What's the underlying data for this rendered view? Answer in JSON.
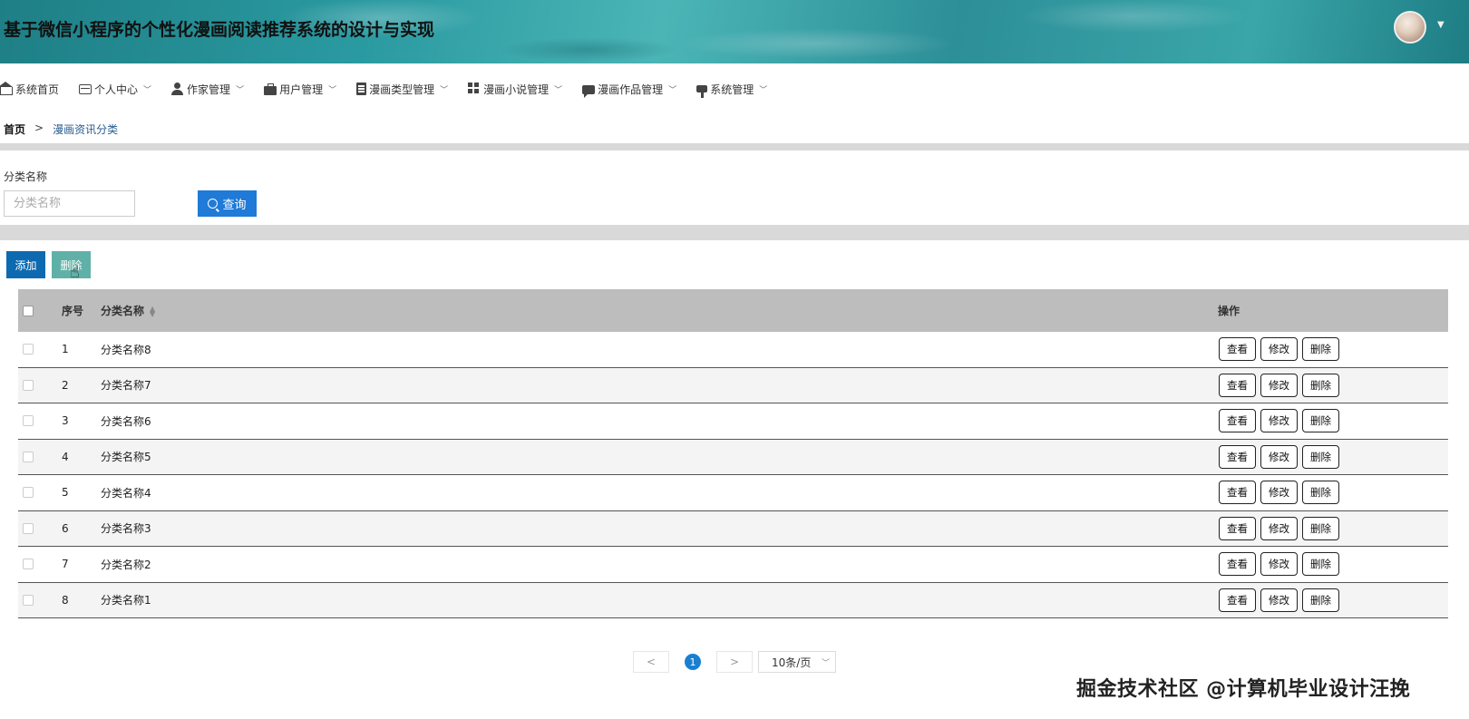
{
  "header": {
    "title": "基于微信小程序的个性化漫画阅读推荐系统的设计与实现"
  },
  "nav": [
    {
      "label": "系统首页",
      "icon": "home-icon",
      "dropdown": false
    },
    {
      "label": "个人中心",
      "icon": "profile-card-icon",
      "dropdown": true
    },
    {
      "label": "作家管理",
      "icon": "user-icon",
      "dropdown": true
    },
    {
      "label": "用户管理",
      "icon": "briefcase-icon",
      "dropdown": true
    },
    {
      "label": "漫画类型管理",
      "icon": "clipboard-icon",
      "dropdown": true
    },
    {
      "label": "漫画小说管理",
      "icon": "grid-icon",
      "dropdown": true
    },
    {
      "label": "漫画作品管理",
      "icon": "chat-icon",
      "dropdown": true
    },
    {
      "label": "系统管理",
      "icon": "pin-icon",
      "dropdown": true
    }
  ],
  "breadcrumb": {
    "home": "首页",
    "separator": ">",
    "current": "漫画资讯分类"
  },
  "search": {
    "label": "分类名称",
    "placeholder": "分类名称",
    "value": "",
    "button": "查询"
  },
  "toolbar": {
    "add": "添加",
    "delete": "删除"
  },
  "table": {
    "headers": {
      "index": "序号",
      "name": "分类名称",
      "actions": "操作"
    },
    "rows": [
      {
        "index": "1",
        "name": "分类名称8"
      },
      {
        "index": "2",
        "name": "分类名称7"
      },
      {
        "index": "3",
        "name": "分类名称6"
      },
      {
        "index": "4",
        "name": "分类名称5"
      },
      {
        "index": "5",
        "name": "分类名称4"
      },
      {
        "index": "6",
        "name": "分类名称3"
      },
      {
        "index": "7",
        "name": "分类名称2"
      },
      {
        "index": "8",
        "name": "分类名称1"
      }
    ],
    "row_actions": {
      "view": "查看",
      "edit": "修改",
      "delete": "删除"
    }
  },
  "pagination": {
    "prev": "<",
    "current_page": "1",
    "next": ">",
    "page_size": "10条/页"
  },
  "watermark": "掘金技术社区 @计算机毕业设计汪挽",
  "colors": {
    "primary_button": "#1f7ad8",
    "add_button": "#0d6ab1",
    "delete_button": "#5fb1a8",
    "table_header": "#bdbdbd",
    "header_teal": "#2a9aa1"
  }
}
